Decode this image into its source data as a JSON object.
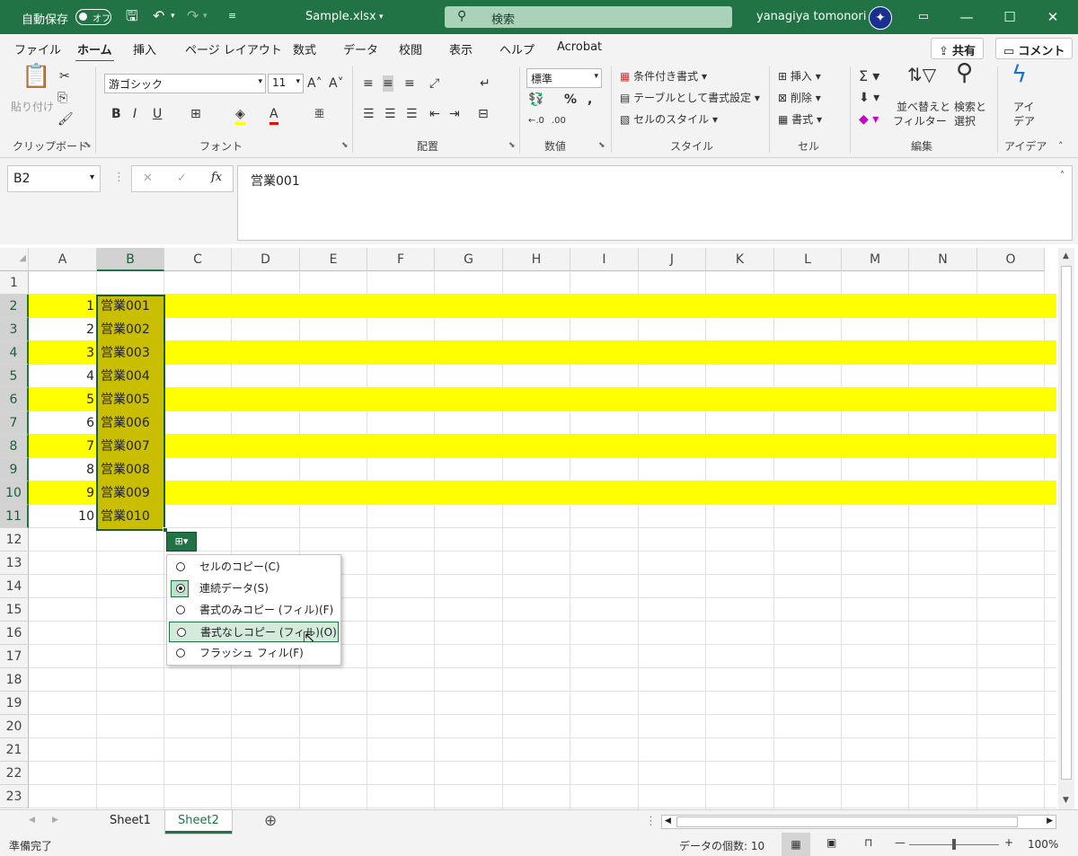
{
  "titlebar": {
    "autosave_label": "自動保存",
    "autosave_state": "オフ",
    "filename": "Sample.xlsx",
    "search_placeholder": "検索",
    "username": "yanagiya tomonori"
  },
  "menu_tabs": [
    "ファイル",
    "ホーム",
    "挿入",
    "ページ レイアウト",
    "数式",
    "データ",
    "校閲",
    "表示",
    "ヘルプ",
    "Acrobat"
  ],
  "share_label": "共有",
  "comment_label": "コメント",
  "ribbon": {
    "clipboard": {
      "paste": "貼り付け",
      "label": "クリップボード"
    },
    "font": {
      "name": "游ゴシック",
      "size": "11",
      "label": "フォント"
    },
    "alignment": {
      "label": "配置"
    },
    "number": {
      "format": "標準",
      "label": "数値"
    },
    "styles": {
      "conditional": "条件付き書式",
      "as_table": "テーブルとして書式設定",
      "cell_styles": "セルのスタイル",
      "label": "スタイル"
    },
    "cells": {
      "insert": "挿入",
      "delete": "削除",
      "format": "書式",
      "label": "セル"
    },
    "editing": {
      "sort1": "並べ替えと",
      "sort2": "フィルター",
      "find1": "検索と",
      "find2": "選択",
      "label": "編集"
    },
    "ideas": {
      "l1": "アイ",
      "l2": "デア",
      "label": "アイデア"
    }
  },
  "formula_bar": {
    "name_box": "B2",
    "fx": "fx",
    "content": "営業001"
  },
  "columns": [
    "A",
    "B",
    "C",
    "D",
    "E",
    "F",
    "G",
    "H",
    "I",
    "J",
    "K",
    "L",
    "M",
    "N",
    "O"
  ],
  "rows": [
    "1",
    "2",
    "3",
    "4",
    "5",
    "6",
    "7",
    "8",
    "9",
    "10",
    "11",
    "12",
    "13",
    "14",
    "15",
    "16",
    "17",
    "18",
    "19",
    "20",
    "21",
    "22",
    "23"
  ],
  "cells": {
    "A": [
      "1",
      "2",
      "3",
      "4",
      "5",
      "6",
      "7",
      "8",
      "9",
      "10"
    ],
    "B": [
      "営業001",
      "営業002",
      "営業003",
      "営業004",
      "営業005",
      "営業006",
      "営業007",
      "営業008",
      "営業009",
      "営業010"
    ]
  },
  "autofill_menu": {
    "items": [
      "セルのコピー(C)",
      "連続データ(S)",
      "書式のみコピー (フィル)(F)",
      "書式なしコピー (フィル)(O)",
      "フラッシュ フィル(F)"
    ],
    "selected": "連続データ(S)",
    "hovered": "書式なしコピー (フィル)(O)"
  },
  "sheets": [
    "Sheet1",
    "Sheet2"
  ],
  "active_sheet": "Sheet2",
  "status": {
    "ready": "準備完了",
    "count_label": "データの個数: 10",
    "zoom": "100%"
  },
  "colors": {
    "accent": "#217346",
    "highlight": "#ffff00",
    "selection_fill": "#c9be00"
  }
}
